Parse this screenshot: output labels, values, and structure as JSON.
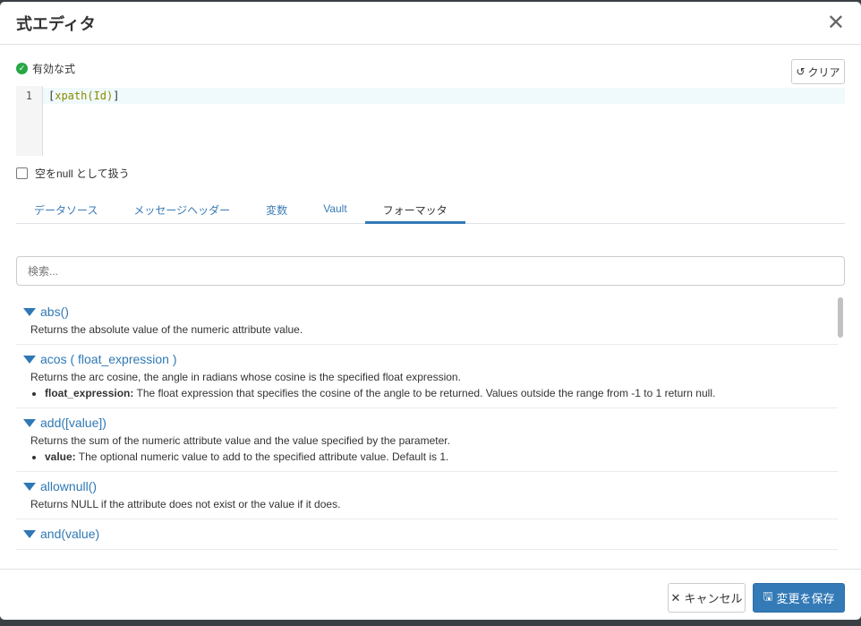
{
  "dialog": {
    "title": "式エディタ",
    "close_icon": "close-icon"
  },
  "status": {
    "label": "有効な式",
    "color": "#28a745"
  },
  "clear_label": "クリア",
  "editor": {
    "line_number": "1",
    "code_open": "[",
    "code_fn": "xpath(Id)",
    "code_close": "]"
  },
  "null_option": {
    "label": "空をnull として扱う",
    "checked": false
  },
  "tabs": [
    {
      "label": "データソース"
    },
    {
      "label": "メッセージヘッダー"
    },
    {
      "label": "変数"
    },
    {
      "label": "Vault"
    },
    {
      "label": "フォーマッタ",
      "active": true
    }
  ],
  "search": {
    "placeholder": "検索..."
  },
  "functions": [
    {
      "name": "abs()",
      "description": "Returns the absolute value of the numeric attribute value."
    },
    {
      "name": "acos ( float_expression )",
      "description": "Returns the arc cosine, the angle in radians whose cosine is the specified float expression.",
      "param_name": "float_expression:",
      "param_desc": " The float expression that specifies the cosine of the angle to be returned. Values outside the range from -1 to 1 return null."
    },
    {
      "name": "add([value])",
      "description": "Returns the sum of the numeric attribute value and the value specified by the parameter.",
      "param_name": "value:",
      "param_desc": " The optional numeric value to add to the specified attribute value. Default is 1."
    },
    {
      "name": "allownull()",
      "description": "Returns NULL if the attribute does not exist or the value if it does."
    },
    {
      "name": "and(value)"
    }
  ],
  "footer": {
    "cancel_label": "キャンセル",
    "save_label": "変更を保存"
  },
  "accent": "#337ab7"
}
